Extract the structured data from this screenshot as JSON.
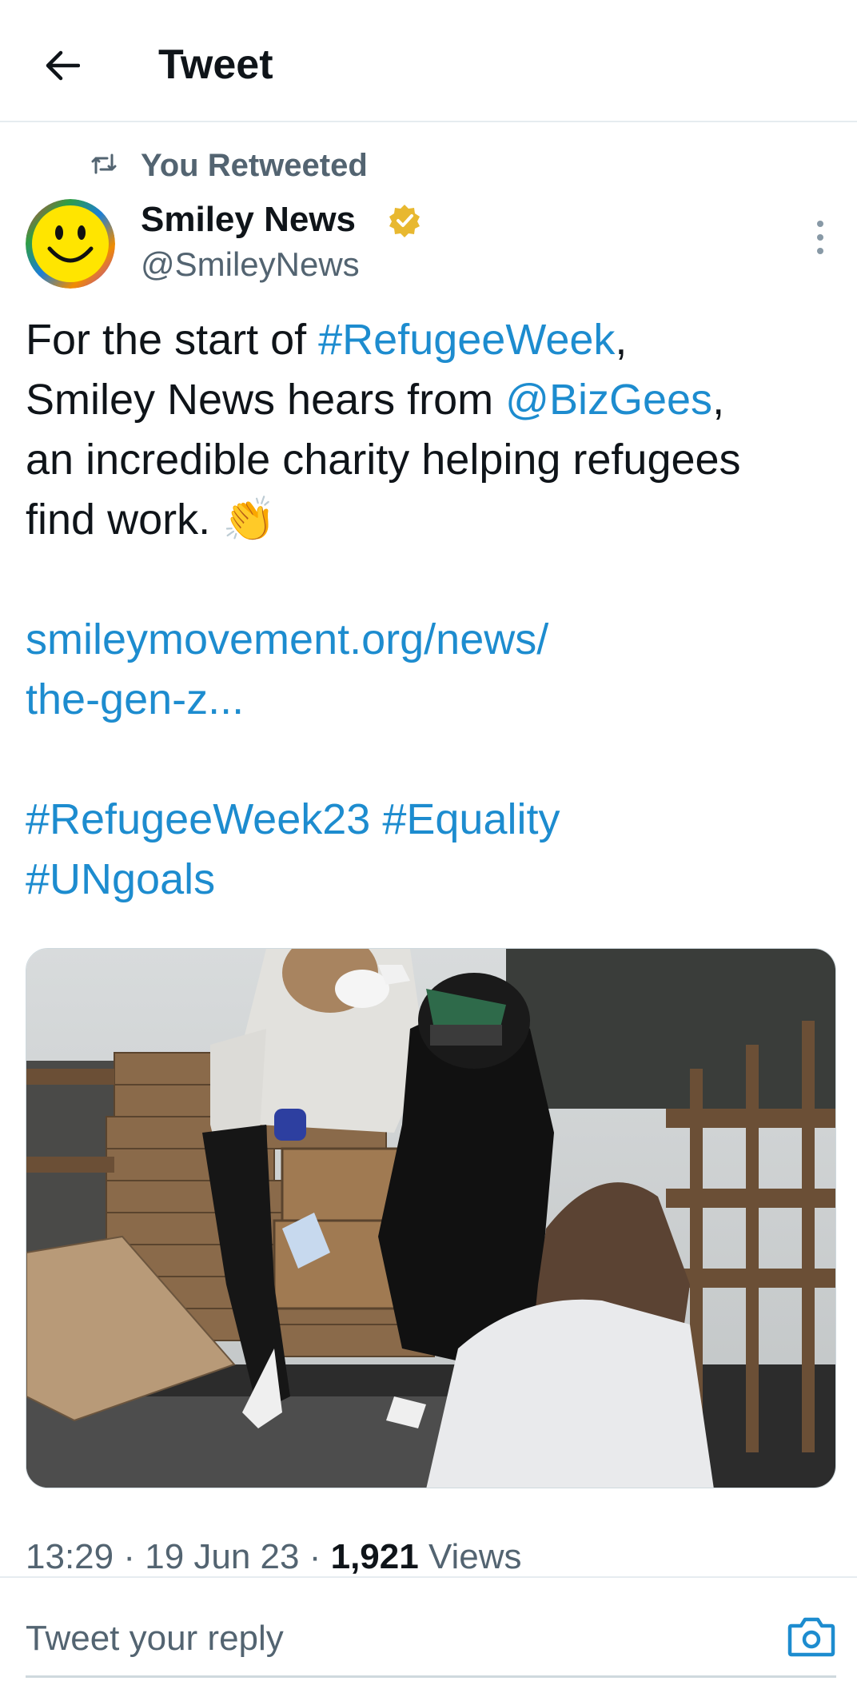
{
  "header": {
    "title": "Tweet",
    "back_icon": "arrow-left-icon"
  },
  "retweet": {
    "icon": "retweet-icon",
    "label": "You Retweeted"
  },
  "author": {
    "name": "Smiley News",
    "handle": "@SmileyNews",
    "verified_icon": "verified-badge-icon",
    "avatar_icon": "smiley-face-icon"
  },
  "tweet": {
    "line1_pre": "For the start of ",
    "hashtag1": "#RefugeeWeek",
    "line1_post": ",",
    "line2_pre": "Smiley News hears from ",
    "mention": "@BizGees",
    "line2_post": ",",
    "line3": "an incredible charity helping refugees",
    "line4": "find work. ",
    "emoji": "👏",
    "link_line1": "smileymovement.org/news/",
    "link_line2": "the-gen-z...",
    "tag_refugeeweek23": "#RefugeeWeek23",
    "tag_equality": "#Equality",
    "tag_ungoals": "#UNgoals"
  },
  "media": {
    "description_icon": "photo-volunteers-unloading-boxes"
  },
  "meta": {
    "time": "13:29",
    "sep1": " · ",
    "date": "19 Jun 23",
    "sep2": " · ",
    "views_count": "1,921",
    "views_label": " Views"
  },
  "reply": {
    "placeholder": "Tweet your reply",
    "camera_icon": "camera-icon"
  },
  "colors": {
    "link": "#1d8ccf",
    "secondary_text": "#536471",
    "primary_text": "#0f1419",
    "verified": "#e8b830"
  }
}
